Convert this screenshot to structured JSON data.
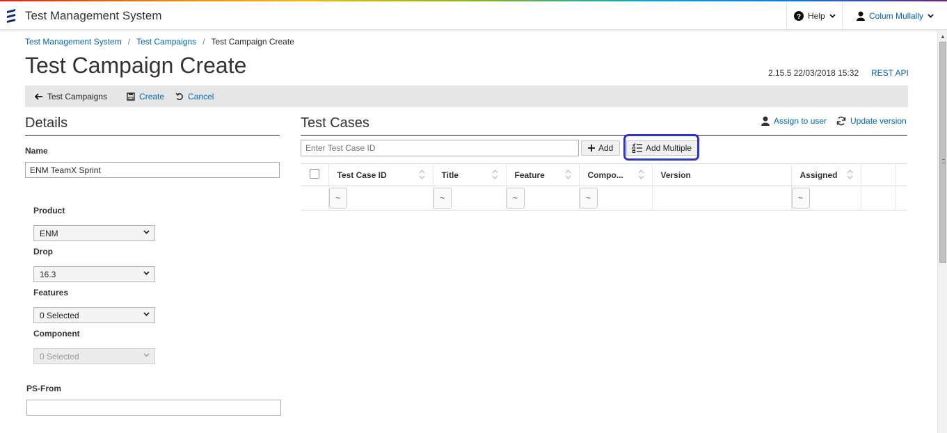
{
  "app": {
    "title": "Test Management System"
  },
  "header": {
    "help_label": "Help",
    "user_name": "Colum Mullally"
  },
  "breadcrumb": {
    "items": [
      "Test Management System",
      "Test Campaigns",
      "Test Campaign Create"
    ],
    "separator": "/"
  },
  "page": {
    "title": "Test Campaign Create",
    "version": "2.15.5 22/03/2018 15:32",
    "rest_api_label": "REST API"
  },
  "actionbar": {
    "back_label": "Test Campaigns",
    "create_label": "Create",
    "cancel_label": "Cancel"
  },
  "details": {
    "title": "Details",
    "name_label": "Name",
    "name_value": "ENM TeamX Sprint",
    "product_label": "Product",
    "product_value": "ENM",
    "drop_label": "Drop",
    "drop_value": "16.3",
    "features_label": "Features",
    "features_value": "0 Selected",
    "component_label": "Component",
    "component_value": "0 Selected",
    "psfrom_label": "PS-From",
    "psfrom_value": ""
  },
  "testcases": {
    "title": "Test Cases",
    "assign_label": "Assign to user",
    "update_label": "Update version",
    "input_placeholder": "Enter Test Case ID",
    "add_label": "Add",
    "add_multiple_label": "Add Multiple",
    "columns": [
      "Test Case ID",
      "Title",
      "Feature",
      "Compo...",
      "Version",
      "Assigned"
    ],
    "filter_symbol": "~"
  },
  "colors": {
    "link": "#0066b3",
    "highlight": "#2f34c4",
    "actionbar": "#e6e6e6"
  }
}
